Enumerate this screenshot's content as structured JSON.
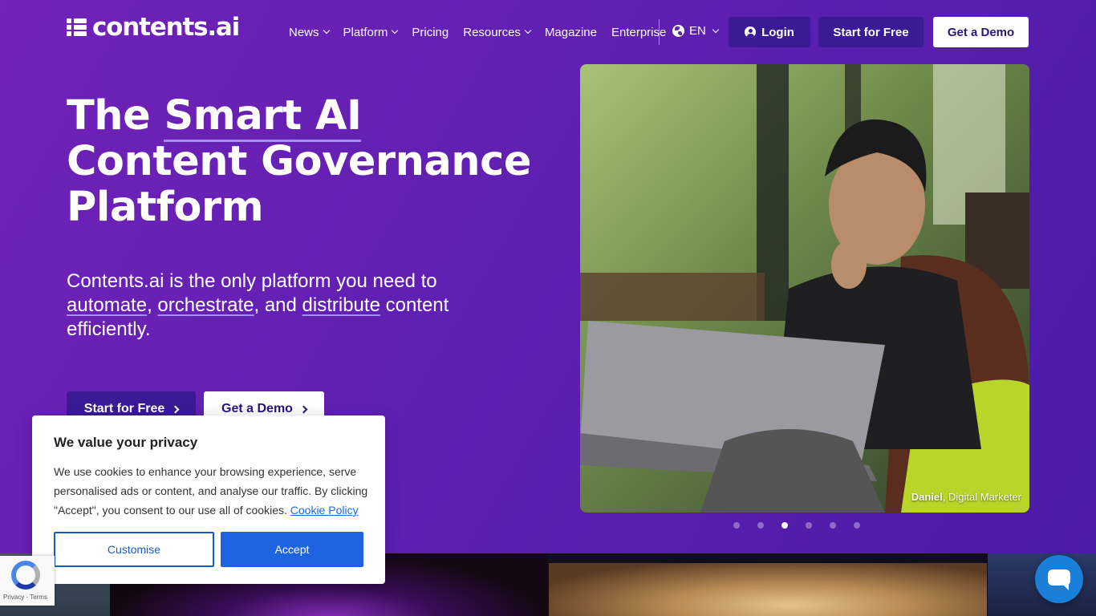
{
  "header": {
    "logo_text": "contents.ai",
    "nav": [
      {
        "label": "News",
        "dropdown": true
      },
      {
        "label": "Platform",
        "dropdown": true
      },
      {
        "label": "Pricing",
        "dropdown": false
      },
      {
        "label": "Resources",
        "dropdown": true
      },
      {
        "label": "Magazine",
        "dropdown": false
      },
      {
        "label": "Enterprise",
        "dropdown": false
      }
    ],
    "language": "EN",
    "login_label": "Login",
    "start_label": "Start for Free",
    "demo_label": "Get a Demo"
  },
  "hero": {
    "title_part1": "The ",
    "title_highlight": "Smart AI",
    "title_part2": "Content Governance Platform",
    "sub_prefix": "Contents.ai is the only platform you need to ",
    "sub_link1": "automate",
    "sub_sep1": ", ",
    "sub_link2": "orchestrate",
    "sub_sep2": ", and ",
    "sub_link3": "distribute",
    "sub_suffix": " content efficiently.",
    "start_label": "Start for Free",
    "demo_label": "Get a Demo",
    "caption_name": "Daniel",
    "caption_role": ", Digital Marketer",
    "carousel_count": 6,
    "carousel_active": 3
  },
  "cookie": {
    "title": "We value your privacy",
    "body": "We use cookies to enhance your browsing experience, serve personalised ads or content, and analyse our traffic. By clicking \"Accept\", you consent to our use all of cookies. ",
    "policy_link": "Cookie Policy",
    "customise_label": "Customise",
    "accept_label": "Accept"
  },
  "recaptcha": {
    "text": "Privacy - Terms"
  },
  "colors": {
    "brand_purple": "#6a21b6",
    "button_dark": "#3b1a96",
    "accept_blue": "#1e64e0",
    "chat_blue": "#1a7fd8"
  },
  "icons": [
    "logo-mark-icon",
    "chevron-down-icon",
    "globe-icon",
    "user-icon",
    "chevron-right-icon",
    "recaptcha-icon",
    "chat-icon"
  ]
}
